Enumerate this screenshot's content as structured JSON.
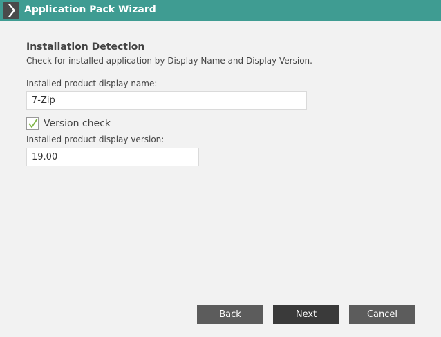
{
  "window": {
    "title": "Application Pack Wizard",
    "accent_color": "#3f9c92",
    "icon": "chevron-right-icon"
  },
  "section": {
    "heading": "Installation Detection",
    "description": "Check for installed application by Display Name and Display Version."
  },
  "display_name": {
    "label": "Installed product display name:",
    "value": "7-Zip"
  },
  "version_check": {
    "label": "Version check",
    "checked": true,
    "check_color": "#7cb342"
  },
  "display_version": {
    "label": "Installed product display version:",
    "value": "19.00"
  },
  "buttons": {
    "back": "Back",
    "next": "Next",
    "cancel": "Cancel"
  }
}
